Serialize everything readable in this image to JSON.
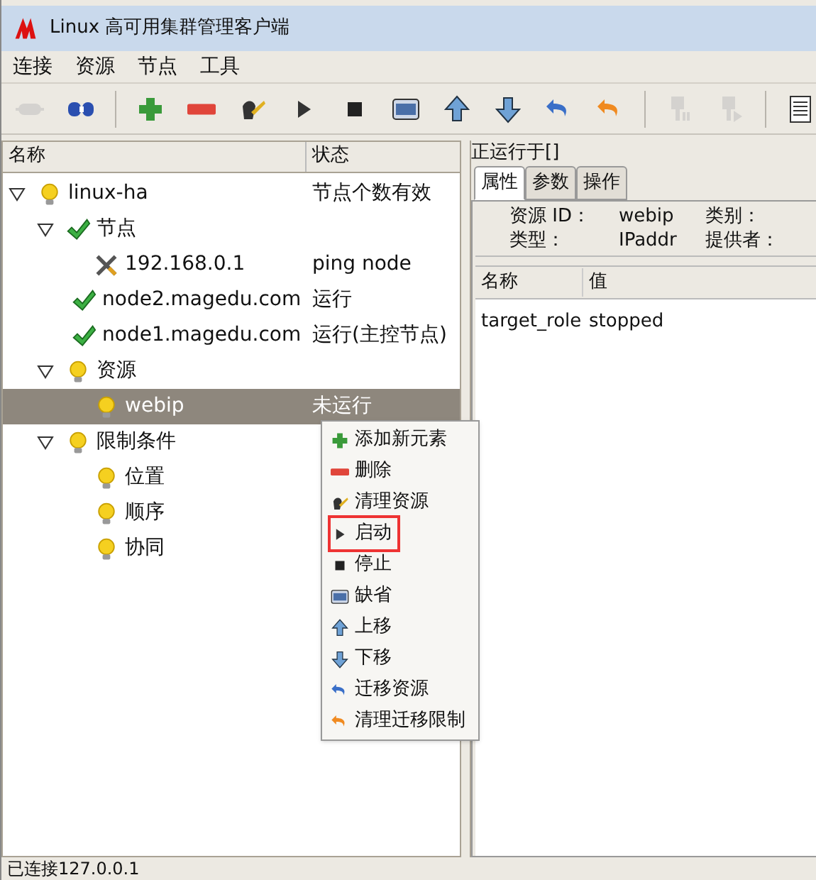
{
  "window": {
    "title": "Linux 高可用集群管理客户端"
  },
  "menu": [
    "连接",
    "资源",
    "节点",
    "工具"
  ],
  "toolbar": [
    {
      "kind": "disconnect",
      "disabled": true
    },
    {
      "kind": "connect",
      "disabled": false
    },
    {
      "kind": "separator"
    },
    {
      "kind": "add",
      "disabled": false
    },
    {
      "kind": "remove",
      "disabled": false
    },
    {
      "kind": "cleanup",
      "disabled": false
    },
    {
      "kind": "start",
      "disabled": false
    },
    {
      "kind": "stop",
      "disabled": false
    },
    {
      "kind": "default",
      "disabled": false
    },
    {
      "kind": "up",
      "disabled": false
    },
    {
      "kind": "down",
      "disabled": false
    },
    {
      "kind": "migrate",
      "disabled": false
    },
    {
      "kind": "unmigrate",
      "disabled": false
    },
    {
      "kind": "separator"
    },
    {
      "kind": "standby",
      "disabled": true
    },
    {
      "kind": "active",
      "disabled": true
    },
    {
      "kind": "separator"
    },
    {
      "kind": "log",
      "disabled": false
    }
  ],
  "tree": {
    "columns": [
      "名称",
      "状态"
    ],
    "items": [
      {
        "name": "linux-ha",
        "status": "节点个数有效",
        "kind": "bulb",
        "expanded": true,
        "selected": false,
        "children": [
          {
            "name": "节点",
            "kind": "check",
            "expanded": true,
            "selected": false,
            "children": [
              {
                "name": "192.168.0.1",
                "status": "ping node",
                "kind": "tools",
                "selected": false
              },
              {
                "name": "node2.magedu.com",
                "status": "运行",
                "kind": "check",
                "selected": false
              },
              {
                "name": "node1.magedu.com",
                "status": "运行(主控节点)",
                "kind": "check",
                "selected": false
              }
            ]
          },
          {
            "name": "资源",
            "kind": "bulb",
            "expanded": true,
            "selected": false,
            "children": [
              {
                "name": "webip",
                "status": "未运行",
                "kind": "bulb",
                "selected": true
              }
            ]
          },
          {
            "name": "限制条件",
            "kind": "bulb",
            "expanded": true,
            "selected": false,
            "children": [
              {
                "name": "位置",
                "kind": "bulb",
                "selected": false
              },
              {
                "name": "顺序",
                "kind": "bulb",
                "selected": false
              },
              {
                "name": "协同",
                "kind": "bulb",
                "selected": false
              }
            ]
          }
        ]
      }
    ]
  },
  "context_menu": [
    {
      "label": "添加新元素",
      "kind": "add",
      "boxed": false
    },
    {
      "label": "删除",
      "kind": "remove",
      "boxed": false
    },
    {
      "label": "清理资源",
      "kind": "cleanup",
      "boxed": false
    },
    {
      "label": "启动",
      "kind": "start",
      "boxed": true
    },
    {
      "label": "停止",
      "kind": "stop",
      "boxed": false
    },
    {
      "label": "缺省",
      "kind": "default",
      "boxed": false
    },
    {
      "label": "上移",
      "kind": "up",
      "boxed": false
    },
    {
      "label": "下移",
      "kind": "down",
      "boxed": false
    },
    {
      "label": "迁移资源",
      "kind": "migrate",
      "boxed": false
    },
    {
      "label": "清理迁移限制",
      "kind": "unmigrate",
      "boxed": false
    }
  ],
  "detail": {
    "title": "正运行于[]",
    "tabs": [
      {
        "label": "属性",
        "selected": true
      },
      {
        "label": "参数",
        "selected": false
      },
      {
        "label": "操作",
        "selected": false
      }
    ],
    "fields": [
      {
        "label": "资源 ID：",
        "value": "webip"
      },
      {
        "label": "类型：",
        "value": "IPaddr"
      }
    ],
    "fields_right": [
      "类别：",
      "提供者："
    ],
    "columns": [
      "名称",
      "值"
    ],
    "rows": [
      [
        "target_role",
        "stopped"
      ]
    ]
  },
  "status_bar": "已连接127.0.0.1"
}
